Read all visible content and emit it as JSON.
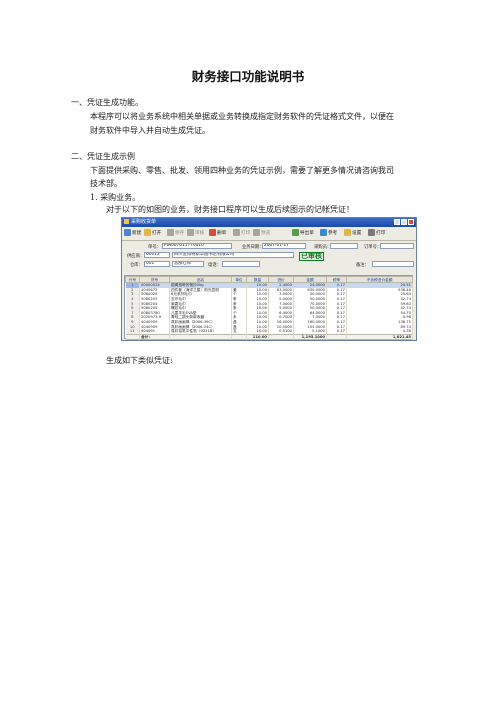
{
  "title": "财务接口功能说明书",
  "doc": {
    "section1_heading": "一、凭证生成功能。",
    "section1_body_line1": "本程序可以将业务系统中相关单据或业务转换成指定财务软件的凭证格式文件，以便在",
    "section1_body_line2": "财务软件中导入并自动生成凭证。",
    "section2_heading": "二、凭证生成示例",
    "section2_body_line1": "下面提供采购、零售、批发、领用四种业务的凭证示例，需要了解更多情况请咨询我司",
    "section2_body_line2": "技术部。",
    "item1_heading": "1.    采购业务。",
    "item1_body": "对于以下的如图的业务，财务接口程序可以生成后续图示的记帐凭证！",
    "after_image": "生成如下类似凭证:"
  },
  "window": {
    "title": "采购收货单",
    "toolbar": [
      {
        "label": "新建",
        "icon": "new-icon",
        "color": "#4a86d4",
        "enabled": true
      },
      {
        "label": "打开",
        "icon": "open-icon",
        "color": "#e0b648",
        "enabled": true
      },
      {
        "label": "保存",
        "icon": "save-icon",
        "color": "#a8a69c",
        "enabled": false
      },
      {
        "label": "审核",
        "icon": "approve-icon",
        "color": "#a8a69c",
        "enabled": false
      },
      {
        "label": "删单",
        "icon": "delete-icon",
        "color": "#d84a3a",
        "enabled": true
      },
      {
        "label": "打印",
        "icon": "print-icon",
        "color": "#a8a69c",
        "enabled": false
      },
      {
        "label": "预览",
        "icon": "preview-icon",
        "color": "#a8a69c",
        "enabled": false
      },
      {
        "label": "导出单",
        "icon": "export-icon",
        "color": "#5a9a4a",
        "enabled": true
      },
      {
        "label": "参考",
        "icon": "reference-icon",
        "color": "#3a8ad0",
        "enabled": true
      },
      {
        "label": "设置",
        "icon": "settings-icon",
        "color": "#e0b648",
        "enabled": true
      },
      {
        "label": "打印",
        "icon": "print-icon",
        "color": "#7a7a7a",
        "enabled": true
      }
    ],
    "form": {
      "doc_no_label": "单号：",
      "doc_no": "PIN0070117T0010",
      "biz_date_label": "业务日期：",
      "biz_date": "2007-01-17",
      "buyer_label": "采购员：",
      "buyer": "",
      "order_no_label": "订单号：",
      "order_no": "",
      "supplier_label": "供应商：",
      "supplier_code": "00013",
      "supplier_name": "四川金博特新华图书店有限公司",
      "status_stamp": "已审核",
      "warehouse_label": "仓库：",
      "warehouse_code": "001",
      "warehouse_name": "总部仓库",
      "phone_label": "电话：",
      "phone": "",
      "remark_label": "备注：",
      "remark": ""
    },
    "table": {
      "columns": [
        "行号",
        "货号",
        "品名",
        "单位",
        "数量",
        "进价",
        "金额",
        "税率",
        "不含税进价金额"
      ],
      "rows": [
        [
          "1",
          "00000024",
          "银阁悠聆的爸抄5kg",
          "",
          "10.00",
          "2.4000",
          "24.0000",
          "0.17",
          "20.51"
        ],
        [
          "2",
          "4040672",
          "四件套（海洋之星）阳光显丽",
          "套",
          "10.00",
          "63.0000",
          "630.0000",
          "0.17",
          "538.46"
        ],
        [
          "3",
          "5080025",
          "6元系列毛巾",
          "个",
          "10.00",
          "3.0000",
          "30.0000",
          "0.17",
          "25.64"
        ],
        [
          "4",
          "5080203",
          "五环毛巾",
          "条",
          "10.00",
          "5.0000",
          "50.0000",
          "0.17",
          "42.74"
        ],
        [
          "5",
          "5080204",
          "紫霜毛巾",
          "条",
          "10.00",
          "7.0000",
          "70.0000",
          "0.17",
          "59.83"
        ],
        [
          "6",
          "5080205",
          "螺纹毛巾",
          "条",
          "10.00",
          "5.0000",
          "50.0000",
          "0.17",
          "42.74"
        ],
        [
          "7",
          "00803780",
          "儿童羊毛EVA垫",
          "个",
          "10.00",
          "6.4000",
          "64.0000",
          "0.17",
          "54.70"
        ],
        [
          "8",
          "2020973-9",
          "青蛙二锅头新款收藏",
          "本",
          "10.00",
          "0.7000",
          "7.0000",
          "0.17",
          "5.98"
        ],
        [
          "9",
          "4040909",
          "真彩画画棒（2006-39C）",
          "盒",
          "10.00",
          "16.0000",
          "160.0000",
          "0.17",
          "136.75"
        ],
        [
          "10",
          "4040909",
          "真彩画画棒（2006-24C）",
          "盒",
          "10.00",
          "10.5000",
          "105.0000",
          "0.17",
          "89.74"
        ],
        [
          "11",
          "404091",
          "真彩铅笔中性笔（0221B）",
          "支",
          "10.00",
          "0.5100",
          "5.1000",
          "0.17",
          "4.36"
        ]
      ],
      "subtotal": {
        "label": "合计：",
        "qty": "110.00",
        "amount": "1,195.1000",
        "net": "1,021.45"
      },
      "total": {
        "label": "合计：",
        "qty": "110.00",
        "amount": "1,195.1000",
        "net": "1,021.45"
      }
    }
  }
}
